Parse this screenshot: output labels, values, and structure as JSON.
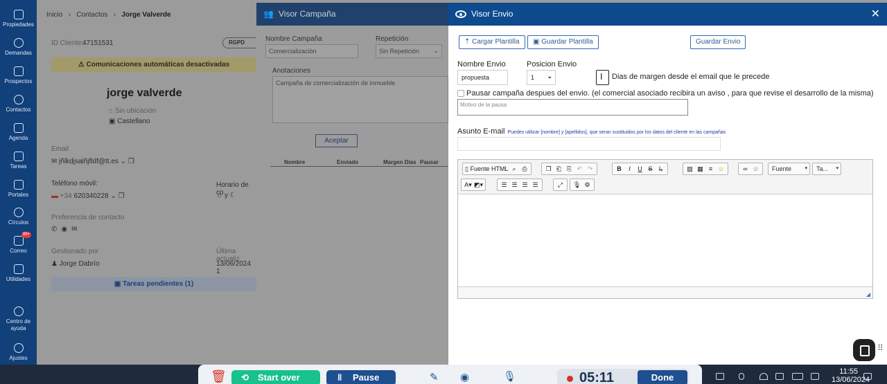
{
  "sidebar": {
    "items": [
      {
        "label": "Propiedades",
        "icon": "home-icon"
      },
      {
        "label": "Demandas",
        "icon": "antenna-icon"
      },
      {
        "label": "Prospectos",
        "icon": "list-icon"
      },
      {
        "label": "Contactos",
        "icon": "user-circle-icon"
      },
      {
        "label": "Agenda",
        "icon": "calendar-icon"
      },
      {
        "label": "Tareas",
        "icon": "checkbox-icon"
      },
      {
        "label": "Portales",
        "icon": "cursor-icon"
      },
      {
        "label": "Círculos",
        "icon": "network-icon"
      },
      {
        "label": "Correo",
        "icon": "mail-icon"
      },
      {
        "label": "Utilidades",
        "icon": "briefcase-icon"
      },
      {
        "label": "Centro de ayuda",
        "icon": "help-icon"
      },
      {
        "label": "Ajustes",
        "icon": "gear-icon"
      }
    ],
    "mail_badge": "99+"
  },
  "contact": {
    "breadcrumb": [
      "Inicio",
      "Contactos",
      "Jorge Valverde"
    ],
    "id_label": "ID Cliente:",
    "id_value": "47151531",
    "rgpd": "RGPD",
    "warning": "Comunicaciones automáticas desactivadas",
    "name": "jorge valverde",
    "location": "Sin ubicación",
    "language": "Castellano",
    "email_label": "Email",
    "email_value": "jñlkdjsalñjfldf@tt.es",
    "phone_label": "Teléfono móvil:",
    "phone_prefix": "+34",
    "phone_value": "620340228",
    "schedule_label": "Horario de co",
    "schedule_value": "y",
    "pref_label": "Preferencia de contacto",
    "managed_label": "Gestionado por",
    "managed_value": "Jorge Dabrío",
    "updated_label": "Última actualiz",
    "updated_value": "13/06/2024 1",
    "tasks": "Tareas pendientes (1)"
  },
  "campana": {
    "title": "Visor Campaña",
    "name_label": "Nombre Campaña",
    "name_value": "Comercialización",
    "repeat_label": "Repetición",
    "repeat_value": "Sin Repetición",
    "notes_label": "Anotaciones",
    "notes_value": "Campaña de comercialización de inmueble",
    "accept": "Aceptar",
    "columns": [
      "Nombre",
      "Enviado",
      "Margen Días",
      "Pausar"
    ]
  },
  "envio": {
    "title": "Visor Envio",
    "load_template": "Cargar Plantilla",
    "save_template": "Guardar Plantilla",
    "save_send": "Guardar Envio",
    "name_label": "Nombre Envio",
    "name_value": "propuesta",
    "position_label": "Posicion Envio",
    "position_value": "1",
    "margin_text": "Dias de margen desde el email que le precede",
    "pause_text": "Pausar campaña despues del envio. (el comercial asociado recibira un aviso , para que revise el desarrollo de la misma)",
    "pause_reason_placeholder": "Motivo de la pausa",
    "subject_label": "Asunto E-mail",
    "subject_hint": "Puedes utilizar [nombre] y [apellidos], que seran sustituidos por los datos del cliente en las campañas",
    "subject_value": "",
    "toolbar": {
      "html_source": "Fuente HTML",
      "font": "Fuente",
      "size": "Ta..."
    }
  },
  "recorder": {
    "start_over": "Start over",
    "pause": "Pause",
    "timer": "05:11",
    "done": "Done"
  },
  "clock": {
    "time": "11:55",
    "date": "13/06/2024"
  }
}
